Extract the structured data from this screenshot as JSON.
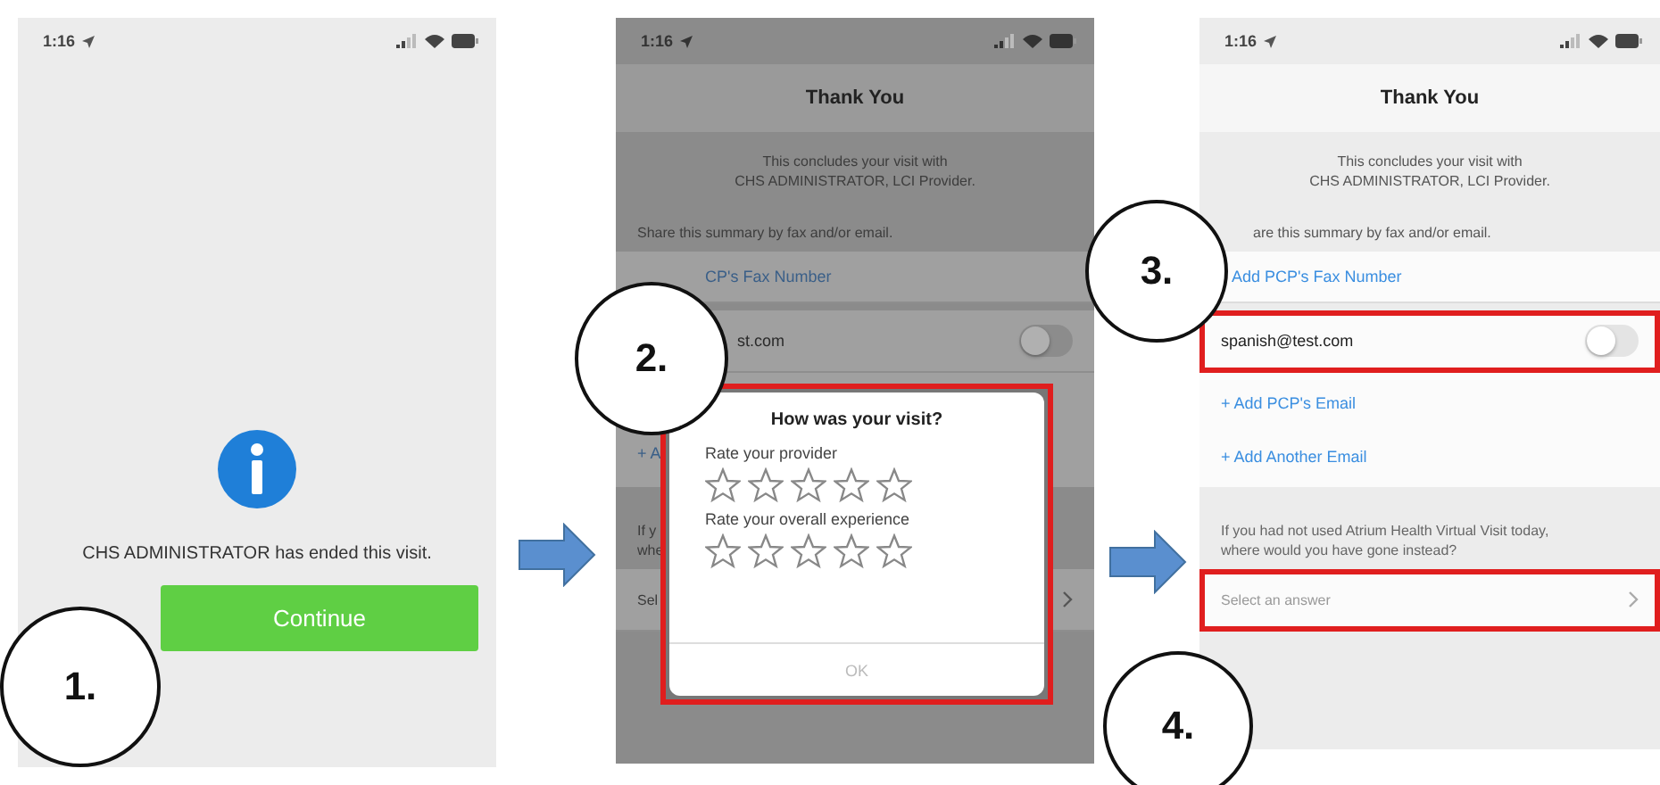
{
  "screen_1": {
    "status_bar": {
      "time": "1:16"
    },
    "message": "CHS ADMINISTRATOR has ended this visit.",
    "button": "Continue"
  },
  "screen_2": {
    "status_bar": {
      "time": "1:16"
    },
    "title": "Thank You",
    "intro": [
      "This concludes your visit with",
      "CHS ADMINISTRATOR, LCI Provider."
    ],
    "share_label": "Share this summary by fax and/or email.",
    "fax_link": "CP's Fax Number",
    "email": {
      "address": "st.com",
      "on": false
    },
    "add_link": "+ A",
    "question": [
      "If y",
      "whe"
    ],
    "select": "Sel",
    "dialog": {
      "title": "How was your visit?",
      "ratings": [
        {
          "label": "Rate your provider",
          "stars": 0
        },
        {
          "label": "Rate your overall experience",
          "stars": 0
        }
      ],
      "ok": {
        "label": "OK",
        "disabled": true
      }
    }
  },
  "screen_3": {
    "status_bar": {
      "time": "1:16"
    },
    "title": "Thank You",
    "intro": [
      "This concludes your visit with",
      "CHS ADMINISTRATOR, LCI Provider."
    ],
    "share_label": "are this summary by fax and/or email.",
    "fax_link": "Add PCP's Fax Number",
    "email": {
      "address": "spanish@test.com",
      "on": false,
      "highlighted": true
    },
    "links": [
      "+ Add PCP's Email",
      "+ Add Another Email"
    ],
    "question": [
      "If you had not used Atrium Health Virtual Visit today,",
      "where would you have gone instead?"
    ],
    "select": {
      "placeholder": "Select an answer",
      "highlighted": true
    }
  },
  "steps": [
    {
      "label": "1."
    },
    {
      "label": "2."
    },
    {
      "label": "3."
    },
    {
      "label": "4."
    }
  ]
}
